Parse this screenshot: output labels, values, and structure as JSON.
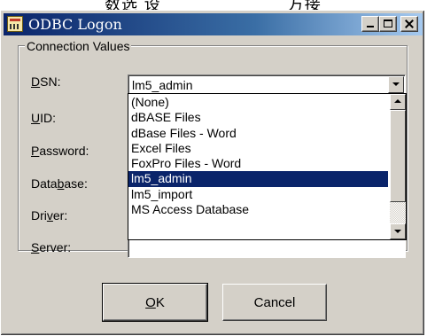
{
  "window": {
    "title": "ODBC Logon"
  },
  "group": {
    "label": "Connection Values"
  },
  "fields": {
    "dsn": {
      "prefix": "",
      "accel": "D",
      "rest": "SN:"
    },
    "uid": {
      "prefix": "",
      "accel": "U",
      "rest": "ID:"
    },
    "password": {
      "prefix": "",
      "accel": "P",
      "rest": "assword:"
    },
    "database": {
      "prefix": "Data",
      "accel": "b",
      "rest": "ase:"
    },
    "driver": {
      "prefix": "Dri",
      "accel": "v",
      "rest": "er:"
    },
    "server": {
      "prefix": "",
      "accel": "S",
      "rest": "erver:"
    }
  },
  "dsn_combo": {
    "value": "lm5_admin",
    "options": [
      "(None)",
      "dBASE Files",
      "dBase Files - Word",
      "Excel Files",
      "FoxPro Files - Word",
      "lm5_admin",
      "lm5_import",
      "MS Access Database"
    ],
    "selected_index": 5
  },
  "buttons": {
    "ok": {
      "accel": "O",
      "rest": "K"
    },
    "cancel": "Cancel"
  },
  "colors": {
    "face": "#d4d0c8",
    "selection": "#0a246a",
    "title_start": "#0a246a",
    "title_end": "#a6caf0"
  },
  "icons": {
    "app": "odbc-app-icon",
    "minimize": "minimize-icon",
    "maximize": "maximize-icon",
    "close": "close-icon"
  }
}
